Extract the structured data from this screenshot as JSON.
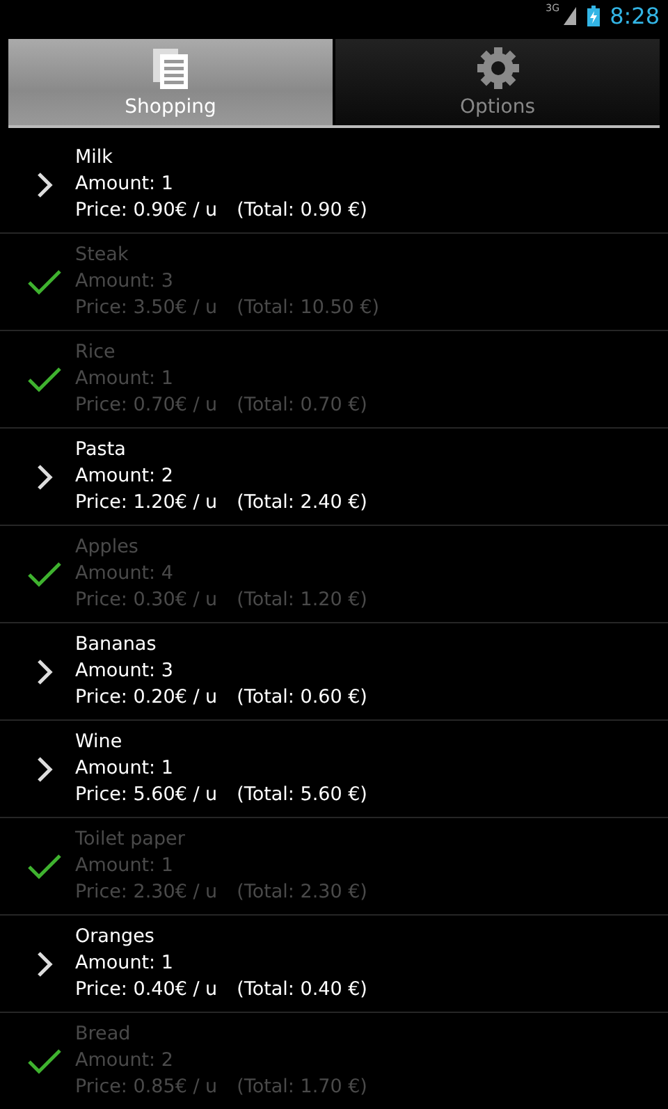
{
  "status_bar": {
    "network": "3G",
    "time": "8:28"
  },
  "tabs": [
    {
      "label": "Shopping",
      "selected": true,
      "kind": "list"
    },
    {
      "label": "Options",
      "selected": false,
      "kind": "gear"
    }
  ],
  "items": [
    {
      "name": "Milk",
      "amount": "Amount: 1",
      "price": "Price: 0.90€ / u",
      "total": "(Total: 0.90 €)",
      "checked": false
    },
    {
      "name": "Steak",
      "amount": "Amount: 3",
      "price": "Price: 3.50€ / u",
      "total": "(Total: 10.50 €)",
      "checked": true
    },
    {
      "name": "Rice",
      "amount": "Amount: 1",
      "price": "Price: 0.70€ / u",
      "total": "(Total: 0.70 €)",
      "checked": true
    },
    {
      "name": "Pasta",
      "amount": "Amount: 2",
      "price": "Price: 1.20€ / u",
      "total": "(Total: 2.40 €)",
      "checked": false
    },
    {
      "name": "Apples",
      "amount": "Amount: 4",
      "price": "Price: 0.30€ / u",
      "total": "(Total: 1.20 €)",
      "checked": true
    },
    {
      "name": "Bananas",
      "amount": "Amount: 3",
      "price": "Price: 0.20€ / u",
      "total": "(Total: 0.60 €)",
      "checked": false
    },
    {
      "name": "Wine",
      "amount": "Amount: 1",
      "price": "Price: 5.60€ / u",
      "total": "(Total: 5.60 €)",
      "checked": false
    },
    {
      "name": "Toilet paper",
      "amount": "Amount: 1",
      "price": "Price: 2.30€ / u",
      "total": "(Total: 2.30 €)",
      "checked": true
    },
    {
      "name": "Oranges",
      "amount": "Amount: 1",
      "price": "Price: 0.40€ / u",
      "total": "(Total: 0.40 €)",
      "checked": false
    },
    {
      "name": "Bread",
      "amount": "Amount: 2",
      "price": "Price: 0.85€ / u",
      "total": "(Total: 1.70 €)",
      "checked": true
    }
  ]
}
